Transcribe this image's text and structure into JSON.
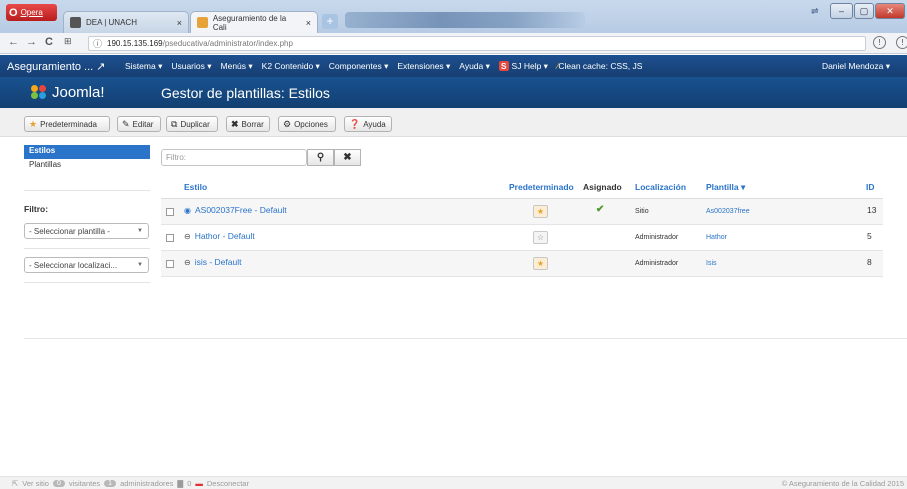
{
  "browser": {
    "opera_label": "Opera",
    "tabs": [
      {
        "title": "DEA | UNACH",
        "favicon_color": "#555555"
      },
      {
        "title": "Aseguramiento de la Cali",
        "favicon_color": "#e8a23a"
      }
    ],
    "close_glyph": "×",
    "new_tab_glyph": "+",
    "url_host": "190.15.135.169",
    "url_path": "/pseducativa/administrator/index.php"
  },
  "topnav": {
    "brand": "Aseguramiento ... ",
    "menu": [
      "Sistema ▾",
      "Usuarios ▾",
      "Menús ▾",
      "K2 Contenido ▾",
      "Componentes ▾",
      "Extensiones ▾",
      "Ayuda ▾"
    ],
    "sj_icon": "S",
    "sj_label": "SJ Help ▾",
    "clean_cache": "Clean cache: CSS, JS",
    "user": "Daniel Mendoza ▾"
  },
  "header": {
    "logo_text": "Joomla!",
    "title": "Gestor de plantillas: Estilos"
  },
  "toolbar": {
    "default_label": "Predeterminada",
    "edit_label": "Editar",
    "duplicate_label": "Duplicar",
    "delete_label": "Borrar",
    "options_label": "Opciones",
    "help_label": "Ayuda"
  },
  "sidebar": {
    "items": [
      {
        "label": "Estilos",
        "active": true
      },
      {
        "label": "Plantillas",
        "active": false
      }
    ],
    "filter_title": "Filtro:",
    "template_select": "- Seleccionar plantilla -",
    "location_select": "- Seleccionar localizaci..."
  },
  "search": {
    "placeholder": "Filtro:"
  },
  "table": {
    "headers": {
      "style": "Estilo",
      "default": "Predeterminado",
      "assigned": "Asignado",
      "location": "Localización",
      "template": "Plantilla ▾",
      "id": "ID"
    },
    "rows": [
      {
        "name": "AS002037Free - Default",
        "status_icon": "eye-icon",
        "default": true,
        "assigned": true,
        "location": "Sitio",
        "template": "As002037free",
        "id": "13"
      },
      {
        "name": "Hathor - Default",
        "status_icon": "minus-circle-icon",
        "default": false,
        "assigned": false,
        "location": "Administrador",
        "template": "Hathor",
        "id": "5"
      },
      {
        "name": "isis - Default",
        "status_icon": "minus-circle-icon",
        "default": true,
        "assigned": false,
        "location": "Administrador",
        "template": "Isis",
        "id": "8"
      }
    ]
  },
  "footer": {
    "view_site": "Ver sitio",
    "visitors_count": "0",
    "visitors_label": "visitantes",
    "admins_count": "1",
    "admins_label": "administradores",
    "messages_count": "0",
    "logout": "Desconectar",
    "copyright": "© Aseguramiento de la Calidad 2015"
  },
  "colors": {
    "nav_blue": "#1d4f8f",
    "link_blue": "#2a74c9",
    "active_blue": "#2a74c9",
    "star_orange": "#e6a130",
    "check_green": "#4d9a2a"
  }
}
